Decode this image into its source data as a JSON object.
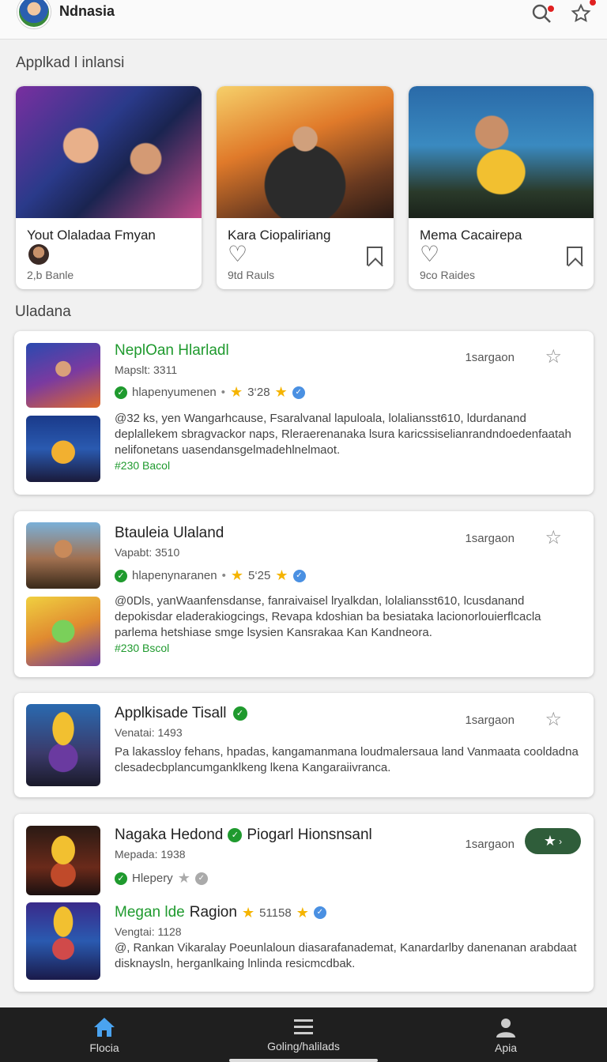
{
  "header": {
    "title": "Ndnasia",
    "search_icon": "search-icon",
    "star_icon": "star-outline-icon"
  },
  "featured": {
    "section_title": "Applkad l inlansi",
    "items": [
      {
        "title": "Yout Olaladaa Fmyan",
        "meta": "2,b Banle"
      },
      {
        "title": "Kara Ciopaliriang",
        "meta": "9td Rauls"
      },
      {
        "title": "Mema Cacairepa",
        "meta": "9co Raides"
      }
    ]
  },
  "list": {
    "section_title": "Uladana",
    "items": [
      {
        "title": "NeplOan Hlarladl",
        "version": "Mapslt: 3311",
        "publisher": "hlapenyumenen",
        "rating": "3‘28",
        "size": "1sargaon",
        "desc": "@32 ks, yen Wangarhcause, Fsaralvanal lapuloala, lolaliansst610, ldurdanand deplallekem sbragvackor naps, Rleraerenanaka lsura karicssiselianrandndoedenfaatah nelifonetans uasendansgelmadehlnelmaot.",
        "tag": "#230 Bacol"
      },
      {
        "title": "Btauleia Ulaland",
        "version": "Vapabt: 3510",
        "publisher": "hlapenynaranen",
        "rating": "5‘25",
        "size": "1sargaon",
        "desc": "@0Dls, yanWaanfensdanse, fanraivaisel lryalkdan, lolaliansst610, lcusdanand depokisdar eladerakiogcings, Revapa kdoshian ba besiataka lacionorlouierflcacla parlema hetshiase smge lsysien Kansrakaa Kan Kandneora.",
        "tag": "#230 Bscol"
      },
      {
        "title": "Applkisade Tisall",
        "version": "Venatai: 1493",
        "size": "1sargaon",
        "desc": "Pa lakassloy fehans, hpadas, kangamanmana loudmalersaua land Vanmaata cooldadna clesadecbplancumganklkeng lkena Kangaraiivranca."
      },
      {
        "title": "Nagaka Hedond",
        "title_suffix": "Piogarl Hionsnsanl",
        "version": "Mepada: 1938",
        "publisher": "Hlepery",
        "size": "1sargaon",
        "sub_title": "Megan lde",
        "sub_title_rest": "Ragion",
        "sub_rating": "51158",
        "sub_version": "Vengtai: 1128",
        "desc": "@, Rankan Vikaralay Poeunlaloun diasarafanademat, Kanardarlby danenanan arabdaat disknaysln, herganlkaing lnlinda resicmcdbak."
      }
    ]
  },
  "bottom_nav": {
    "items": [
      {
        "label": "Flocia",
        "icon": "home-icon"
      },
      {
        "label": "Goling/halilads",
        "icon": "menu-icon"
      },
      {
        "label": "Apia",
        "icon": "person-icon"
      }
    ]
  },
  "colors": {
    "accent_green": "#1f9a2e",
    "nav_bg": "#1f1f1f",
    "nav_active": "#4aa3f0",
    "notification": "#e02020"
  }
}
